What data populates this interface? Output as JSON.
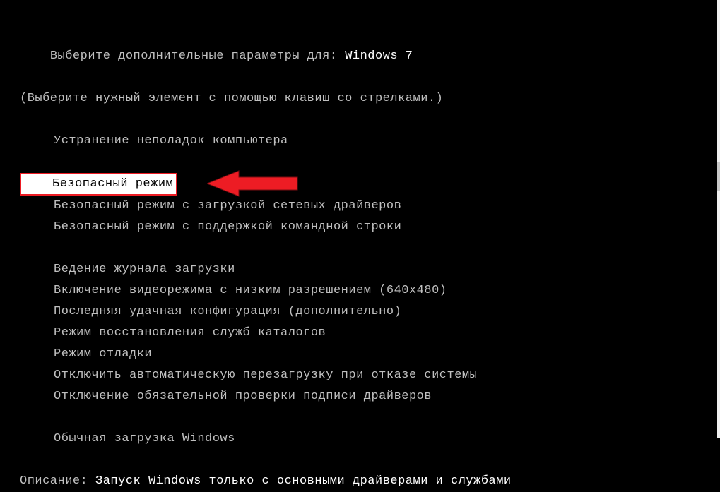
{
  "header": {
    "title_prefix": "Выберите дополнительные параметры для:",
    "os_name": "Windows 7",
    "instruction": "(Выберите нужный элемент с помощью клавиш со стрелками.)"
  },
  "options": {
    "repair": "Устранение неполадок компьютера",
    "safe_mode": "Безопасный режим",
    "safe_mode_net": "Безопасный режим с загрузкой сетевых драйверов",
    "safe_mode_cmd": "Безопасный режим с поддержкой командной строки",
    "boot_log": "Ведение журнала загрузки",
    "low_res": "Включение видеорежима с низким разрешением (640x480)",
    "last_good": "Последняя удачная конфигурация (дополнительно)",
    "ds_restore": "Режим восстановления служб каталогов",
    "debug": "Режим отладки",
    "no_auto_restart": "Отключить автоматическую перезагрузку при отказе системы",
    "disable_sig": "Отключение обязательной проверки подписи драйверов",
    "normal": "Обычная загрузка Windows"
  },
  "description": {
    "label": "Описание:",
    "text": "Запуск Windows только с основными драйверами и службами"
  },
  "colors": {
    "highlight_border": "#ed1c24",
    "highlight_bg": "#ffffff",
    "arrow": "#ed1c24"
  }
}
